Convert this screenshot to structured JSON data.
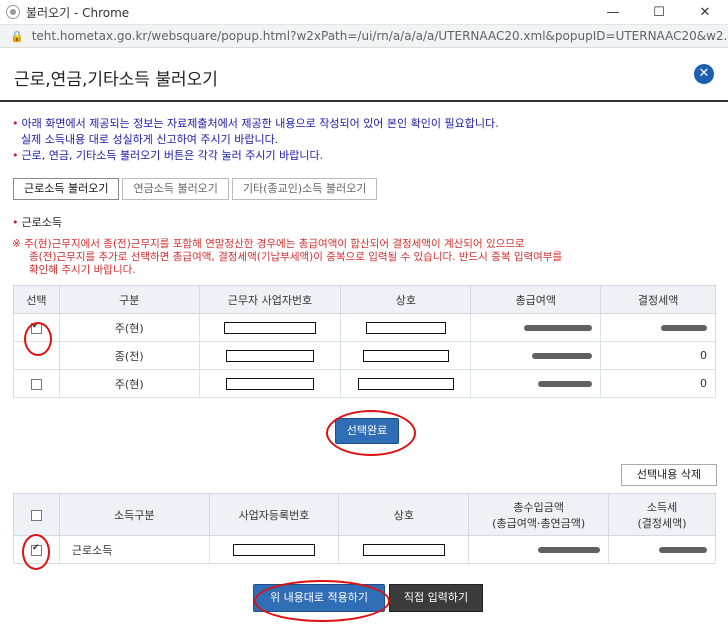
{
  "window": {
    "title": "불러오기 - Chrome",
    "url": "teht.hometax.go.kr/websquare/popup.html?w2xPath=/ui/rn/a/a/a/a/UTERNAAC20.xml&popupID=UTERNAAC20&w2..."
  },
  "header": {
    "title": "근로,연금,기타소득 불러오기",
    "close_icon": "close-icon"
  },
  "notices": [
    "아래 화면에서 제공되는 정보는 자료제출처에서 제공한 내용으로 작성되어 있어 본인 확인이 필요합니다.",
    "실제 소득내용 대로 성실하게 신고하여 주시기 바랍니다.",
    "근로, 연금, 기타소득 불러오기 버튼은 각각 눌러 주시기 바랍니다."
  ],
  "tabs": [
    "근로소득 불러오기",
    "연금소득 불러오기",
    "기타(종교인)소득 불러오기"
  ],
  "section": {
    "label": "근로소득"
  },
  "warning": [
    "※ 주(현)근무지에서 종(전)근무지를 포함해 연말정산한 경우에는 총급여액이 합산되어 결정세액이 계산되어 있으므로",
    "종(전)근무지를 추가로 선택하면 총급여액, 결정세액(기납부세액)이 중복으로 입력될 수 있습니다. 반드시 중복 입력여부를",
    "확인해 주시기 바랍니다."
  ],
  "table1": {
    "headers": [
      "선택",
      "구분",
      "근무자 사업자번호",
      "상호",
      "총급여액",
      "결정세액"
    ],
    "rows": [
      {
        "checked": true,
        "type": "주(현)",
        "tax": ""
      },
      {
        "checked": false,
        "type": "종(전)",
        "tax": "0"
      },
      {
        "checked": false,
        "type": "주(현)",
        "tax": "0"
      }
    ]
  },
  "buttons": {
    "select_done": "선택완료",
    "delete_selected": "선택내용 삭제",
    "apply": "위 내용대로 적용하기",
    "manual_input": "직접 입력하기"
  },
  "table2": {
    "headers": [
      "",
      "소득구분",
      "사업자등록번호",
      "상호",
      "총수입금액",
      "소득세"
    ],
    "subheaders": [
      "(총급여액·총연금액)",
      "(결정세액)"
    ],
    "rows": [
      {
        "checked": true,
        "type": "근로소득"
      }
    ]
  },
  "colors": {
    "accent": "#2f6db5",
    "warning": "#d32f2f",
    "notice": "#1a1aa8"
  }
}
